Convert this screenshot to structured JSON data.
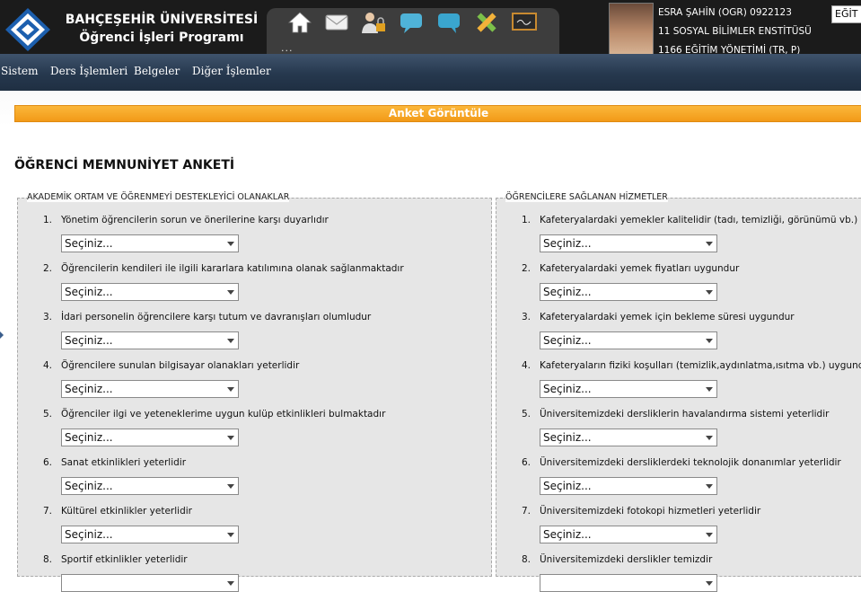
{
  "header": {
    "university_line1": "BAHÇEŞEHİR ÜNİVERSİTESİ",
    "university_line2": "Öğrenci İşleri Programı",
    "icon_dots": "...",
    "user": {
      "line1": "ESRA ŞAHİN (OGR) 0922123",
      "line2": "11 SOSYAL BİLİMLER ENSTİTÜSÜ",
      "line3": "1166 EĞİTİM YÖNETİMİ (TR, P)"
    },
    "lang_label": "EĞİT"
  },
  "toolbar_icons": [
    "home-icon",
    "mail-icon",
    "user-lock-icon",
    "chat-bubble-icon",
    "chat-bubble-icon",
    "pencil-ruler-icon",
    "chalkboard-icon"
  ],
  "nav": {
    "items": [
      "Sistem",
      "Ders İşlemleri",
      "Belgeler",
      "Diğer İşlemler"
    ]
  },
  "page": {
    "section_title": "Anket Görüntüle",
    "survey_title": "ÖĞRENCİ MEMNUNİYET ANKETİ"
  },
  "panels": [
    {
      "legend": "AKADEMİK ORTAM VE ÖĞRENMEYİ DESTEKLEYİCİ OLANAKLAR",
      "questions": [
        {
          "num": "1.",
          "text": "Yönetim öğrencilerin sorun ve önerilerine karşı duyarlıdır",
          "value": "Seçiniz..."
        },
        {
          "num": "2.",
          "text": "Öğrencilerin kendileri ile ilgili kararlara katılımına olanak sağlanmaktadır",
          "value": "Seçiniz..."
        },
        {
          "num": "3.",
          "text": "İdari personelin öğrencilere karşı tutum ve davranışları olumludur",
          "value": "Seçiniz..."
        },
        {
          "num": "4.",
          "text": "Öğrencilere sunulan bilgisayar olanakları yeterlidir",
          "value": "Seçiniz..."
        },
        {
          "num": "5.",
          "text": "Öğrenciler ilgi ve yeteneklerime uygun kulüp etkinlikleri bulmaktadır",
          "value": "Seçiniz..."
        },
        {
          "num": "6.",
          "text": "Sanat etkinlikleri yeterlidir",
          "value": "Seçiniz..."
        },
        {
          "num": "7.",
          "text": "Kültürel etkinlikler yeterlidir",
          "value": "Seçiniz..."
        },
        {
          "num": "8.",
          "text": "Sportif etkinlikler yeterlidir",
          "value": ""
        }
      ]
    },
    {
      "legend": "ÖĞRENCİLERE SAĞLANAN HİZMETLER",
      "questions": [
        {
          "num": "1.",
          "text": "Kafeteryalardaki yemekler kalitelidir (tadı, temizliği, görünümü vb.)",
          "value": "Seçiniz..."
        },
        {
          "num": "2.",
          "text": "Kafeteryalardaki yemek fiyatları uygundur",
          "value": "Seçiniz..."
        },
        {
          "num": "3.",
          "text": "Kafeteryalardaki yemek için bekleme süresi uygundur",
          "value": "Seçiniz..."
        },
        {
          "num": "4.",
          "text": "Kafeteryaların fiziki koşulları (temizlik,aydınlatma,ısıtma vb.) uygundur",
          "value": "Seçiniz..."
        },
        {
          "num": "5.",
          "text": "Üniversitemizdeki dersliklerin havalandırma sistemi yeterlidir",
          "value": "Seçiniz..."
        },
        {
          "num": "6.",
          "text": "Üniversitemizdeki dersliklerdeki teknolojik donanımlar yeterlidir",
          "value": "Seçiniz..."
        },
        {
          "num": "7.",
          "text": "Üniversitemizdeki fotokopi hizmetleri yeterlidir",
          "value": "Seçiniz..."
        },
        {
          "num": "8.",
          "text": "Üniversitemizdeki derslikler temizdir",
          "value": ""
        }
      ]
    }
  ]
}
